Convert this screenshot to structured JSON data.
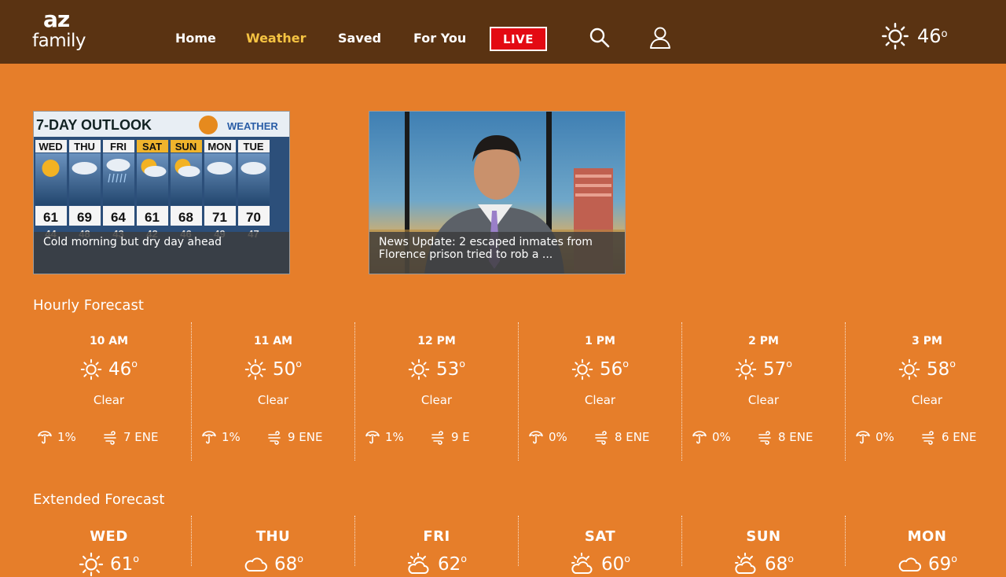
{
  "header": {
    "logo_line1": "az",
    "logo_line2": "family",
    "nav": [
      {
        "label": "Home"
      },
      {
        "label": "Weather"
      },
      {
        "label": "Saved"
      },
      {
        "label": "For You"
      }
    ],
    "live_label": "LIVE",
    "current_temp": "46",
    "current_icon": "sun-icon",
    "search_icon": "search-icon",
    "account_icon": "user-icon",
    "accent_active": "#F5C342",
    "live_color": "#E30A13"
  },
  "videos": [
    {
      "thumb_title": "7-DAY OUTLOOK",
      "thumb_brand": "WEATHER",
      "thumb_days": [
        "WED",
        "THU",
        "FRI",
        "SAT",
        "SUN",
        "MON",
        "TUE"
      ],
      "thumb_highs": [
        "61",
        "69",
        "64",
        "61",
        "68",
        "71",
        "70"
      ],
      "thumb_lows": [
        "44",
        "48",
        "43",
        "42",
        "46",
        "49",
        "47"
      ],
      "caption": "Cold morning but dry day ahead"
    },
    {
      "caption": "News Update: 2 escaped inmates from Florence prison tried to rob a ..."
    }
  ],
  "hourly": {
    "title": "Hourly Forecast",
    "items": [
      {
        "time": "10 AM",
        "temp": "46",
        "cond": "Clear",
        "precip": "1%",
        "wind": "7 ENE",
        "icon": "sun-icon"
      },
      {
        "time": "11 AM",
        "temp": "50",
        "cond": "Clear",
        "precip": "1%",
        "wind": "9 ENE",
        "icon": "sun-icon"
      },
      {
        "time": "12 PM",
        "temp": "53",
        "cond": "Clear",
        "precip": "1%",
        "wind": "9 E",
        "icon": "sun-icon"
      },
      {
        "time": "1 PM",
        "temp": "56",
        "cond": "Clear",
        "precip": "0%",
        "wind": "8 ENE",
        "icon": "sun-icon"
      },
      {
        "time": "2 PM",
        "temp": "57",
        "cond": "Clear",
        "precip": "0%",
        "wind": "8 ENE",
        "icon": "sun-icon"
      },
      {
        "time": "3 PM",
        "temp": "58",
        "cond": "Clear",
        "precip": "0%",
        "wind": "6 ENE",
        "icon": "sun-icon"
      }
    ]
  },
  "extended": {
    "title": "Extended Forecast",
    "items": [
      {
        "day": "WED",
        "temp": "61",
        "icon": "sun-icon"
      },
      {
        "day": "THU",
        "temp": "68",
        "icon": "cloud-icon"
      },
      {
        "day": "FRI",
        "temp": "62",
        "icon": "partly-cloudy-icon"
      },
      {
        "day": "SAT",
        "temp": "60",
        "icon": "partly-cloudy-icon"
      },
      {
        "day": "SUN",
        "temp": "68",
        "icon": "partly-cloudy-icon"
      },
      {
        "day": "MON",
        "temp": "69",
        "icon": "cloud-icon"
      }
    ]
  }
}
